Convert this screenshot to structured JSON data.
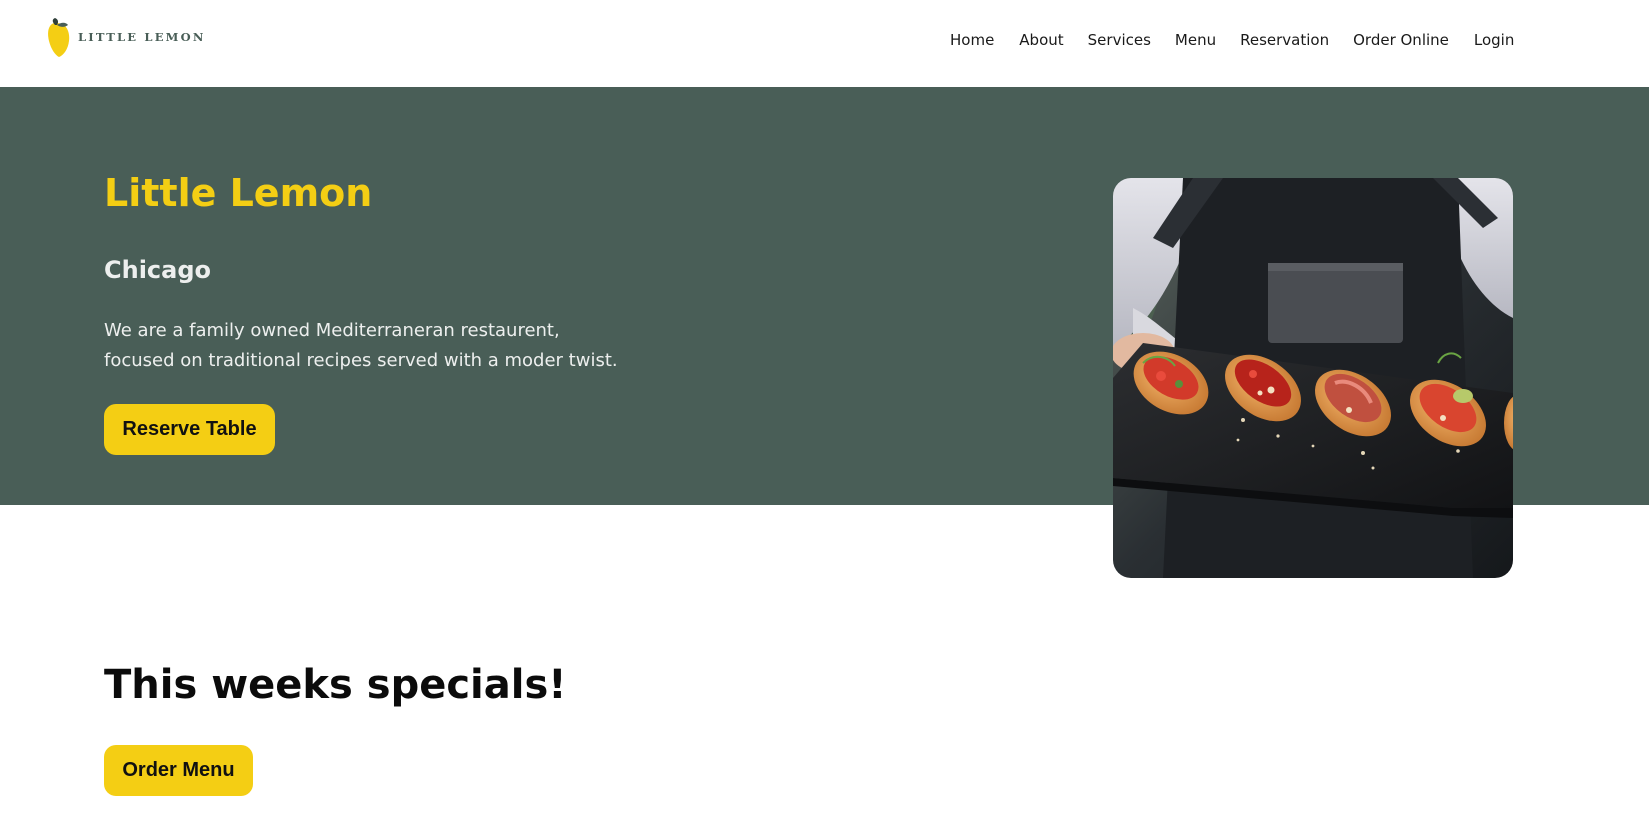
{
  "brand": {
    "logo_text": "LITTLE LEMON"
  },
  "nav": {
    "items": [
      {
        "label": "Home"
      },
      {
        "label": "About"
      },
      {
        "label": "Services"
      },
      {
        "label": "Menu"
      },
      {
        "label": "Reservation"
      },
      {
        "label": "Order Online"
      },
      {
        "label": "Login"
      }
    ]
  },
  "hero": {
    "title": "Little Lemon",
    "subtitle": "Chicago",
    "description": "We are a family owned Mediterraneran restaurent, focused on traditional recipes served with a moder twist.",
    "cta_label": "Reserve Table",
    "image_icon": "bruschetta-photo"
  },
  "specials": {
    "title": "This weeks specials!",
    "cta_label": "Order Menu"
  },
  "colors": {
    "primary_green": "#495e57",
    "primary_yellow": "#f4ce14",
    "highlight_light": "#edefee",
    "text_dark": "#111111",
    "background": "#ffffff"
  }
}
